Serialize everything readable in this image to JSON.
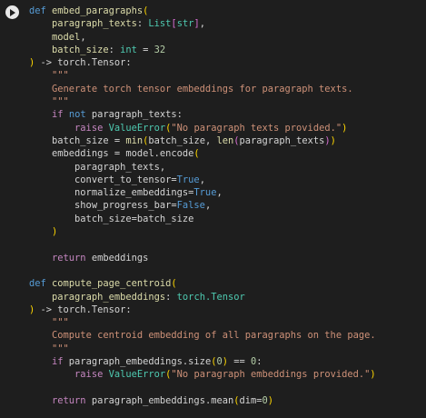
{
  "colors": {
    "background": "#1e1e1e",
    "keyword": "#569cd6",
    "control": "#c586c0",
    "function": "#dcdcaa",
    "class": "#4ec9b0",
    "string": "#ce9178",
    "number": "#b5cea8",
    "bracket_level1": "#ffd700",
    "bracket_level2": "#da70d6",
    "default_text": "#d4d4d4"
  },
  "cell": {
    "run_icon": "play-circle-icon"
  },
  "code": {
    "lines": [
      [
        [
          "kw",
          "def"
        ],
        [
          "op",
          " "
        ],
        [
          "fn",
          "embed_paragraphs"
        ],
        [
          "br1",
          "("
        ]
      ],
      [
        [
          "op",
          "    "
        ],
        [
          "fn",
          "paragraph_texts"
        ],
        [
          "op",
          ": "
        ],
        [
          "cls",
          "List"
        ],
        [
          "br2",
          "["
        ],
        [
          "cls",
          "str"
        ],
        [
          "br2",
          "]"
        ],
        [
          "op",
          ","
        ]
      ],
      [
        [
          "op",
          "    "
        ],
        [
          "fn",
          "model"
        ],
        [
          "op",
          ","
        ]
      ],
      [
        [
          "op",
          "    "
        ],
        [
          "fn",
          "batch_size"
        ],
        [
          "op",
          ": "
        ],
        [
          "cls",
          "int"
        ],
        [
          "op",
          " = "
        ],
        [
          "num",
          "32"
        ]
      ],
      [
        [
          "br1",
          ")"
        ],
        [
          "op",
          " -> torch.Tensor:"
        ]
      ],
      [
        [
          "op",
          "    "
        ],
        [
          "str",
          "\"\"\""
        ]
      ],
      [
        [
          "op",
          "    "
        ],
        [
          "str",
          "Generate torch tensor embeddings for paragraph texts."
        ]
      ],
      [
        [
          "op",
          "    "
        ],
        [
          "str",
          "\"\"\""
        ]
      ],
      [
        [
          "op",
          "    "
        ],
        [
          "ctl",
          "if"
        ],
        [
          "op",
          " "
        ],
        [
          "kw",
          "not"
        ],
        [
          "op",
          " paragraph_texts:"
        ]
      ],
      [
        [
          "op",
          "        "
        ],
        [
          "ctl",
          "raise"
        ],
        [
          "op",
          " "
        ],
        [
          "cls",
          "ValueError"
        ],
        [
          "br1",
          "("
        ],
        [
          "str",
          "\"No paragraph texts provided.\""
        ],
        [
          "br1",
          ")"
        ]
      ],
      [
        [
          "op",
          "    batch_size = "
        ],
        [
          "fn",
          "min"
        ],
        [
          "br1",
          "("
        ],
        [
          "op",
          "batch_size, "
        ],
        [
          "fn",
          "len"
        ],
        [
          "br2",
          "("
        ],
        [
          "op",
          "paragraph_texts"
        ],
        [
          "br2",
          ")"
        ],
        [
          "br1",
          ")"
        ]
      ],
      [
        [
          "op",
          "    embeddings = model.encode"
        ],
        [
          "br1",
          "("
        ]
      ],
      [
        [
          "op",
          "        paragraph_texts,"
        ]
      ],
      [
        [
          "op",
          "        convert_to_tensor="
        ],
        [
          "kw",
          "True"
        ],
        [
          "op",
          ","
        ]
      ],
      [
        [
          "op",
          "        normalize_embeddings="
        ],
        [
          "kw",
          "True"
        ],
        [
          "op",
          ","
        ]
      ],
      [
        [
          "op",
          "        show_progress_bar="
        ],
        [
          "kw",
          "False"
        ],
        [
          "op",
          ","
        ]
      ],
      [
        [
          "op",
          "        batch_size=batch_size"
        ]
      ],
      [
        [
          "op",
          "    "
        ],
        [
          "br1",
          ")"
        ]
      ],
      [
        [
          "op",
          ""
        ]
      ],
      [
        [
          "op",
          "    "
        ],
        [
          "ctl",
          "return"
        ],
        [
          "op",
          " embeddings"
        ]
      ],
      [
        [
          "op",
          ""
        ]
      ],
      [
        [
          "kw",
          "def"
        ],
        [
          "op",
          " "
        ],
        [
          "fn",
          "compute_page_centroid"
        ],
        [
          "br1",
          "("
        ]
      ],
      [
        [
          "op",
          "    "
        ],
        [
          "fn",
          "paragraph_embeddings"
        ],
        [
          "op",
          ": "
        ],
        [
          "cls",
          "torch.Tensor"
        ]
      ],
      [
        [
          "br1",
          ")"
        ],
        [
          "op",
          " -> torch.Tensor:"
        ]
      ],
      [
        [
          "op",
          "    "
        ],
        [
          "str",
          "\"\"\""
        ]
      ],
      [
        [
          "op",
          "    "
        ],
        [
          "str",
          "Compute centroid embedding of all paragraphs on the page."
        ]
      ],
      [
        [
          "op",
          "    "
        ],
        [
          "str",
          "\"\"\""
        ]
      ],
      [
        [
          "op",
          "    "
        ],
        [
          "ctl",
          "if"
        ],
        [
          "op",
          " paragraph_embeddings.size"
        ],
        [
          "br1",
          "("
        ],
        [
          "num",
          "0"
        ],
        [
          "br1",
          ")"
        ],
        [
          "op",
          " == "
        ],
        [
          "num",
          "0"
        ],
        [
          "op",
          ":"
        ]
      ],
      [
        [
          "op",
          "        "
        ],
        [
          "ctl",
          "raise"
        ],
        [
          "op",
          " "
        ],
        [
          "cls",
          "ValueError"
        ],
        [
          "br1",
          "("
        ],
        [
          "str",
          "\"No paragraph embeddings provided.\""
        ],
        [
          "br1",
          ")"
        ]
      ],
      [
        [
          "op",
          ""
        ]
      ],
      [
        [
          "op",
          "    "
        ],
        [
          "ctl",
          "return"
        ],
        [
          "op",
          " paragraph_embeddings.mean"
        ],
        [
          "br1",
          "("
        ],
        [
          "op",
          "dim="
        ],
        [
          "num",
          "0"
        ],
        [
          "br1",
          ")"
        ]
      ]
    ]
  }
}
